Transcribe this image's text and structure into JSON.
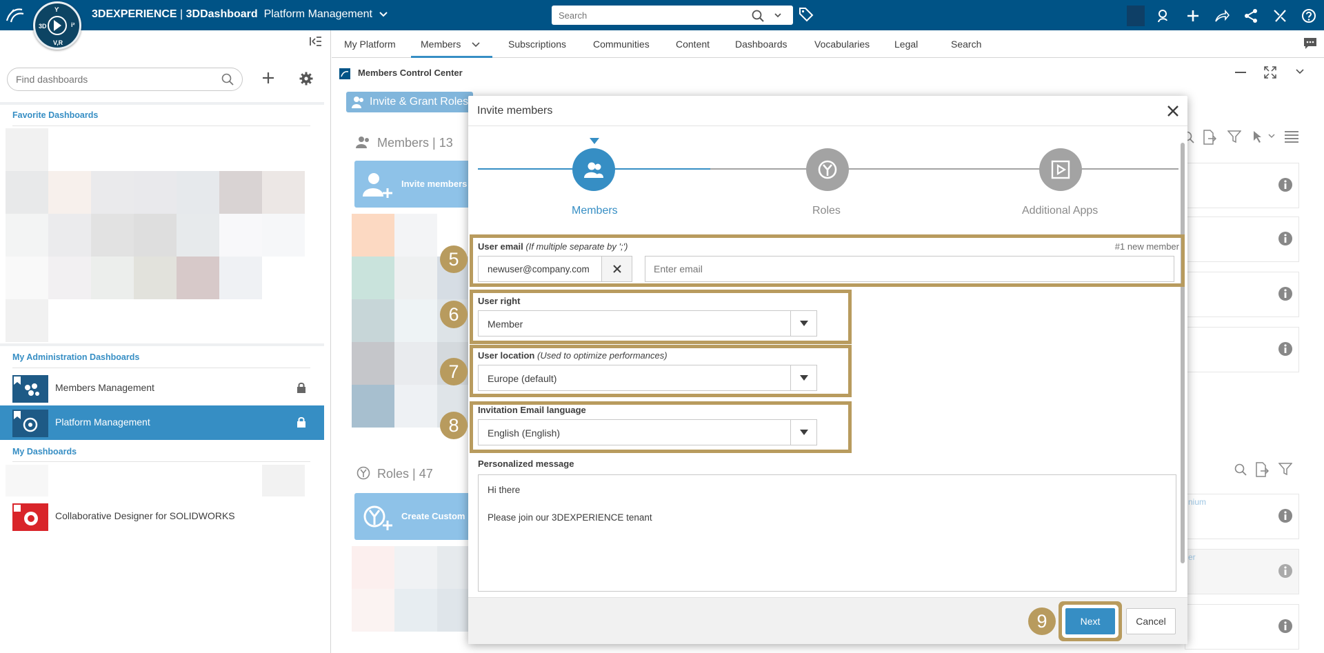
{
  "topbar": {
    "brand": "3DEXPERIENCE",
    "separator": " | ",
    "product": "3DDashboard",
    "dashboard_name": "Platform Management",
    "search_placeholder": "Search",
    "compass_labels": {
      "top": "Ƴ",
      "left": "3D",
      "right": "i²",
      "bottom": "V,R"
    },
    "icons": [
      "add-user-icon",
      "plus-icon",
      "share-icon",
      "network-icon",
      "tools-icon",
      "help-icon"
    ]
  },
  "sidebar": {
    "find_placeholder": "Find dashboards",
    "favorites_title": "Favorite Dashboards",
    "admin_title": "My Administration Dashboards",
    "admin_items": [
      {
        "label": "Members Management"
      },
      {
        "label": "Platform Management"
      }
    ],
    "my_title": "My Dashboards",
    "my_items": [
      {
        "label": "Collaborative Designer for SOLIDWORKS"
      }
    ]
  },
  "tabs": [
    {
      "label": "My Platform"
    },
    {
      "label": "Members"
    },
    {
      "label": "Subscriptions"
    },
    {
      "label": "Communities"
    },
    {
      "label": "Content"
    },
    {
      "label": "Dashboards"
    },
    {
      "label": "Vocabularies"
    },
    {
      "label": "Legal"
    },
    {
      "label": "Search"
    }
  ],
  "widget": {
    "title": "Members Control Center",
    "invite_grant": "Invite & Grant Roles",
    "members_header": "Members | 13",
    "invite_card": "Invite members",
    "roles_header": "Roles | 47",
    "create_card": "Create Custom",
    "peek_texts": [
      "nium",
      "er"
    ]
  },
  "modal": {
    "title": "Invite members",
    "steps": [
      {
        "label": "Members"
      },
      {
        "label": "Roles"
      },
      {
        "label": "Additional Apps"
      }
    ],
    "email": {
      "label": "User email",
      "hint": "(If multiple separate by ';')",
      "counter": "#1 new member",
      "chip": "newuser@company.com",
      "placeholder": "Enter email",
      "badge": "5"
    },
    "user_right": {
      "label": "User right",
      "value": "Member",
      "badge": "6"
    },
    "user_location": {
      "label": "User location",
      "hint": "(Used to optimize performances)",
      "value": "Europe (default)",
      "badge": "7"
    },
    "email_language": {
      "label": "Invitation Email language",
      "value": "English (English)",
      "badge": "8"
    },
    "message": {
      "label": "Personalized message",
      "text": "Hi there\n\nPlease join our 3DEXPERIENCE tenant"
    },
    "next_label": "Next",
    "cancel_label": "Cancel",
    "next_badge": "9"
  },
  "colors": {
    "topbar": "#005386",
    "accent": "#368ec4",
    "callout": "#b89b5e",
    "step_inactive": "#a3a3a3"
  }
}
